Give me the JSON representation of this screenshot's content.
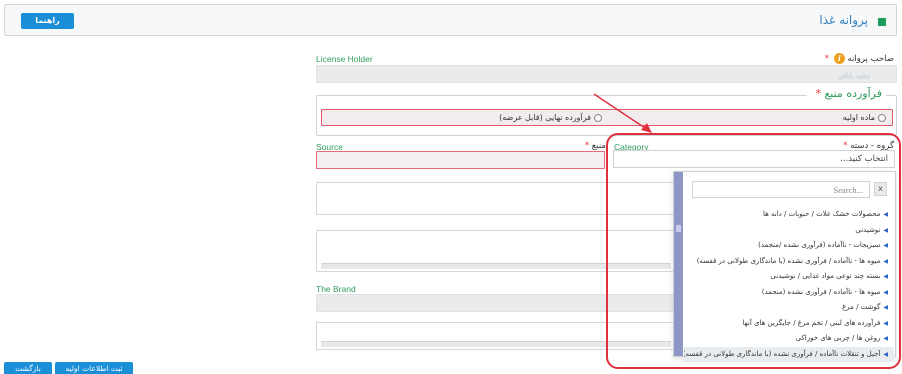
{
  "header": {
    "title": "پروانه غذا",
    "help_button": "راهنما"
  },
  "license_holder": {
    "label_en": "License Holder",
    "label_fa": "صاحب پروانه",
    "required": "*",
    "info_icon": "i",
    "value": "مجید بابائی"
  },
  "source_product": {
    "legend": "فرآورده منبع",
    "required": "*",
    "options": [
      {
        "label": "ماده اولیه",
        "selected": false
      },
      {
        "label": "فرآورده نهایی (قابل عرضه)",
        "selected": false
      }
    ]
  },
  "category": {
    "label_en": "Category",
    "label_fa": "گروه - دسته",
    "required": "*",
    "placeholder": "انتخاب کنید..."
  },
  "source": {
    "label_en": "Source",
    "label_fa": "منبع",
    "required": "*"
  },
  "brand": {
    "label_en": "The Brand"
  },
  "dropdown": {
    "search_placeholder": "Search...",
    "close_label": "x",
    "highlighted_index": 9,
    "items": [
      "محصولات خشک غلات / حبوبات / دانه ها",
      "نوشیدنی",
      "سبزیجات - ناآماده (فرآوری نشده /منجمد)",
      "میوه ها - ناآماده / فرآوری نشده (با ماندگاری طولانی در قفسه)",
      "بسته چند نوعی مواد غذایی / نوشیدنی",
      "میوه ها - ناآماده / فرآوری نشده (منجمد)",
      "گوشت / مرغ",
      "فرآورده های لبنی / تخم مرغ / جایگزین های آنها",
      "روغن ها / چربی های خوراکی",
      "آجیل و تنقلات ناآماده / فرآوری نشده (با ماندگاری طولانی در قفسه)"
    ]
  },
  "footer": {
    "buttons": [
      "ثبت اطلاعات اولیه",
      "بازگشت"
    ]
  },
  "colors": {
    "accent": "#1a8fd8",
    "label_green": "#2f9a5c",
    "error_border": "#e26b79",
    "annotation_red": "#e0303c"
  }
}
